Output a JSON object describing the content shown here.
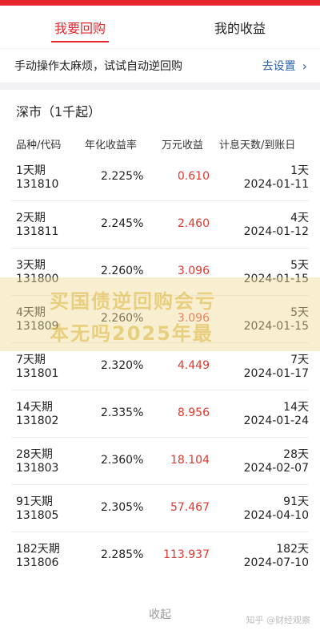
{
  "tabs": [
    {
      "label": "我要回购",
      "active": true
    },
    {
      "label": "我的收益",
      "active": false
    }
  ],
  "tip": {
    "text": "手动操作太麻烦，试试自动逆回购",
    "link": "去设置"
  },
  "section": {
    "title": "深市（1千起）"
  },
  "table": {
    "headers": [
      "品种/代码",
      "年化收益率",
      "万元收益",
      "计息天数/到账日"
    ],
    "rows": [
      {
        "name": "1天期",
        "code": "131810",
        "rate": "2.225%",
        "yield": "0.610",
        "days": "1天",
        "date": "2024-01-11"
      },
      {
        "name": "2天期",
        "code": "131811",
        "rate": "2.245%",
        "yield": "2.460",
        "days": "4天",
        "date": "2024-01-12"
      },
      {
        "name": "3天期",
        "code": "131800",
        "rate": "2.260%",
        "yield": "3.096",
        "days": "5天",
        "date": "2024-01-15"
      },
      {
        "name": "4天期",
        "code": "131809",
        "rate": "2.260%",
        "yield": "3.096",
        "days": "5天",
        "date": "2024-01-15"
      },
      {
        "name": "7天期",
        "code": "131801",
        "rate": "2.320%",
        "yield": "4.449",
        "days": "7天",
        "date": "2024-01-17"
      },
      {
        "name": "14天期",
        "code": "131802",
        "rate": "2.335%",
        "yield": "8.956",
        "days": "14天",
        "date": "2024-01-24"
      },
      {
        "name": "28天期",
        "code": "131803",
        "rate": "2.360%",
        "yield": "18.104",
        "days": "28天",
        "date": "2024-02-07"
      },
      {
        "name": "91天期",
        "code": "131805",
        "rate": "2.305%",
        "yield": "57.467",
        "days": "91天",
        "date": "2024-04-10"
      },
      {
        "name": "182天期",
        "code": "131806",
        "rate": "2.285%",
        "yield": "113.937",
        "days": "182天",
        "date": "2024-07-10"
      }
    ]
  },
  "collapse_label": "收起",
  "watermark": {
    "line1": "买国债逆回购会亏",
    "line2": "本无吗2025年最"
  },
  "footer_mark": "知乎 @财经观察"
}
